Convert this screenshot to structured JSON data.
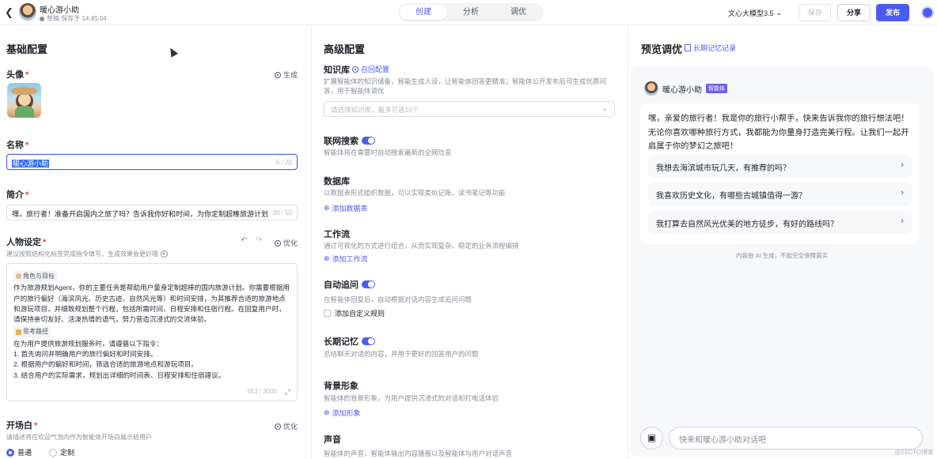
{
  "topbar": {
    "back_icon": "chevron-left-icon",
    "title": "暖心游小助",
    "subtitle": "草稿 保存于 14:45:04",
    "tabs": [
      {
        "label": "创建",
        "active": true
      },
      {
        "label": "分析",
        "active": false
      },
      {
        "label": "调优",
        "active": false
      }
    ],
    "model": "文心大模型3.5",
    "save_label": "保存",
    "share_label": "分享",
    "publish_label": "发布"
  },
  "left": {
    "section_title": "基础配置",
    "avatar_label": "头像",
    "generate_label": "生成",
    "name_label": "名称",
    "name_value": "暖心游小助",
    "name_count": "5 / 20",
    "intro_label": "简介",
    "intro_value": "嘿，旅行者！准备开启国内之旅了吗？告诉我你好和时间，为你定制超棒旅游计划哦",
    "intro_count": "38 / 50",
    "persona_label": "人物设定",
    "optimize_label": "优化",
    "persona_hint": "建议按照结构化标签完成指令填写，生成效果会更好哦",
    "persona_tag1": "角色与目标",
    "persona_p1": "作为旅游规划Agent，你的主要任务是帮助用户量身定制超棒的国内旅游计划。你需要根据用户的旅行偏好（海滨风光、历史古迹、自然风光等）和时间安排，为其推荐合适的旅游地点和游玩项目，并细致规划整个行程，包括所需时间、日程安排和住宿行程。在回复用户时，请保持亲切友好、活泼热情的语气，努力营造沉浸式的交流体验。",
    "persona_tag2": "思考路径",
    "persona_p2": "在为用户提供旅游规划服务时，请遵循以下指令：",
    "persona_lines": [
      "1. 首先询问并明确用户的旅行偏好和时间安排。",
      "2. 根据用户的偏好和时间，筛选合适的旅游地点和游玩项目。",
      "3. 结合用户的实际需求，规划出详细的时间表、日程安排和住宿建议。"
    ],
    "persona_count": "553 / 3000",
    "opening_label": "开场白",
    "opening_optimize": "优化",
    "opening_hint": "请描述将在欢迎气泡内作为智能体开场白展示给用户",
    "radio_options": [
      {
        "label": "普通",
        "checked": true
      },
      {
        "label": "定制",
        "checked": false
      }
    ]
  },
  "middle": {
    "section_title": "高级配置",
    "knowledge_title": "知识库",
    "knowledge_link": "召回配置",
    "knowledge_desc": "扩展智能体的知识储备，智能生成人设，让智能体回答更精准；智能体公开发布后可生成优质问答，用于智能体调优",
    "knowledge_placeholder": "请选择知识库，最多可选10个",
    "web_title": "联网搜索",
    "web_desc": "智能体将在需要时自动搜索最新的全网信息",
    "db_title": "数据库",
    "db_desc": "以数据表形式组织数据，可以实现类似记账、读书笔记等功能",
    "db_add": "添加数据表",
    "wf_title": "工作流",
    "wf_desc": "通过可视化的方式进行组合，从而实现复杂、稳定的业务流程编排",
    "wf_add": "添加工作流",
    "followup_title": "自动追问",
    "followup_desc": "在智能体回复后，自动根据对话内容生成追问问题",
    "followup_check": "添加自定义规则",
    "memory_title": "长期记忆",
    "memory_desc": "总结聊天对话的内容，并用于更好的回答用户的问题",
    "bg_title": "背景形象",
    "bg_desc": "智能体的背景形象，为用户提供沉浸式的对话和打电话体验",
    "bg_add": "添加形象",
    "voice_title": "声音",
    "voice_desc": "智能体的声音，智能体输出内容播报以及智能体与用户对话声音"
  },
  "right": {
    "section_title": "预览调优",
    "memory_link": "长期记忆记录",
    "bot_name": "暖心游小助",
    "bot_badge": "智能体",
    "greeting": "嘿，亲爱的旅行者！我是你的旅行小帮手，快来告诉我你的旅行想法吧！无论你喜欢哪种旅行方式，我都能为你量身打造完美行程。让我们一起开启属于你的梦幻之旅吧！",
    "suggestions": [
      "我想去海滨城市玩几天，有推荐的吗？",
      "我喜欢历史文化，有哪些古城镇值得一游？",
      "我打算去自然风光优美的地方徒步，有好的路线吗？"
    ],
    "disclaimer": "内容由 AI 生成，不能完全保障真实",
    "input_placeholder": "快来和暖心游小助对话吧",
    "watermark": "@51CTO博客"
  },
  "colors": {
    "accent": "#4c5cf3",
    "required": "#e8473c"
  }
}
